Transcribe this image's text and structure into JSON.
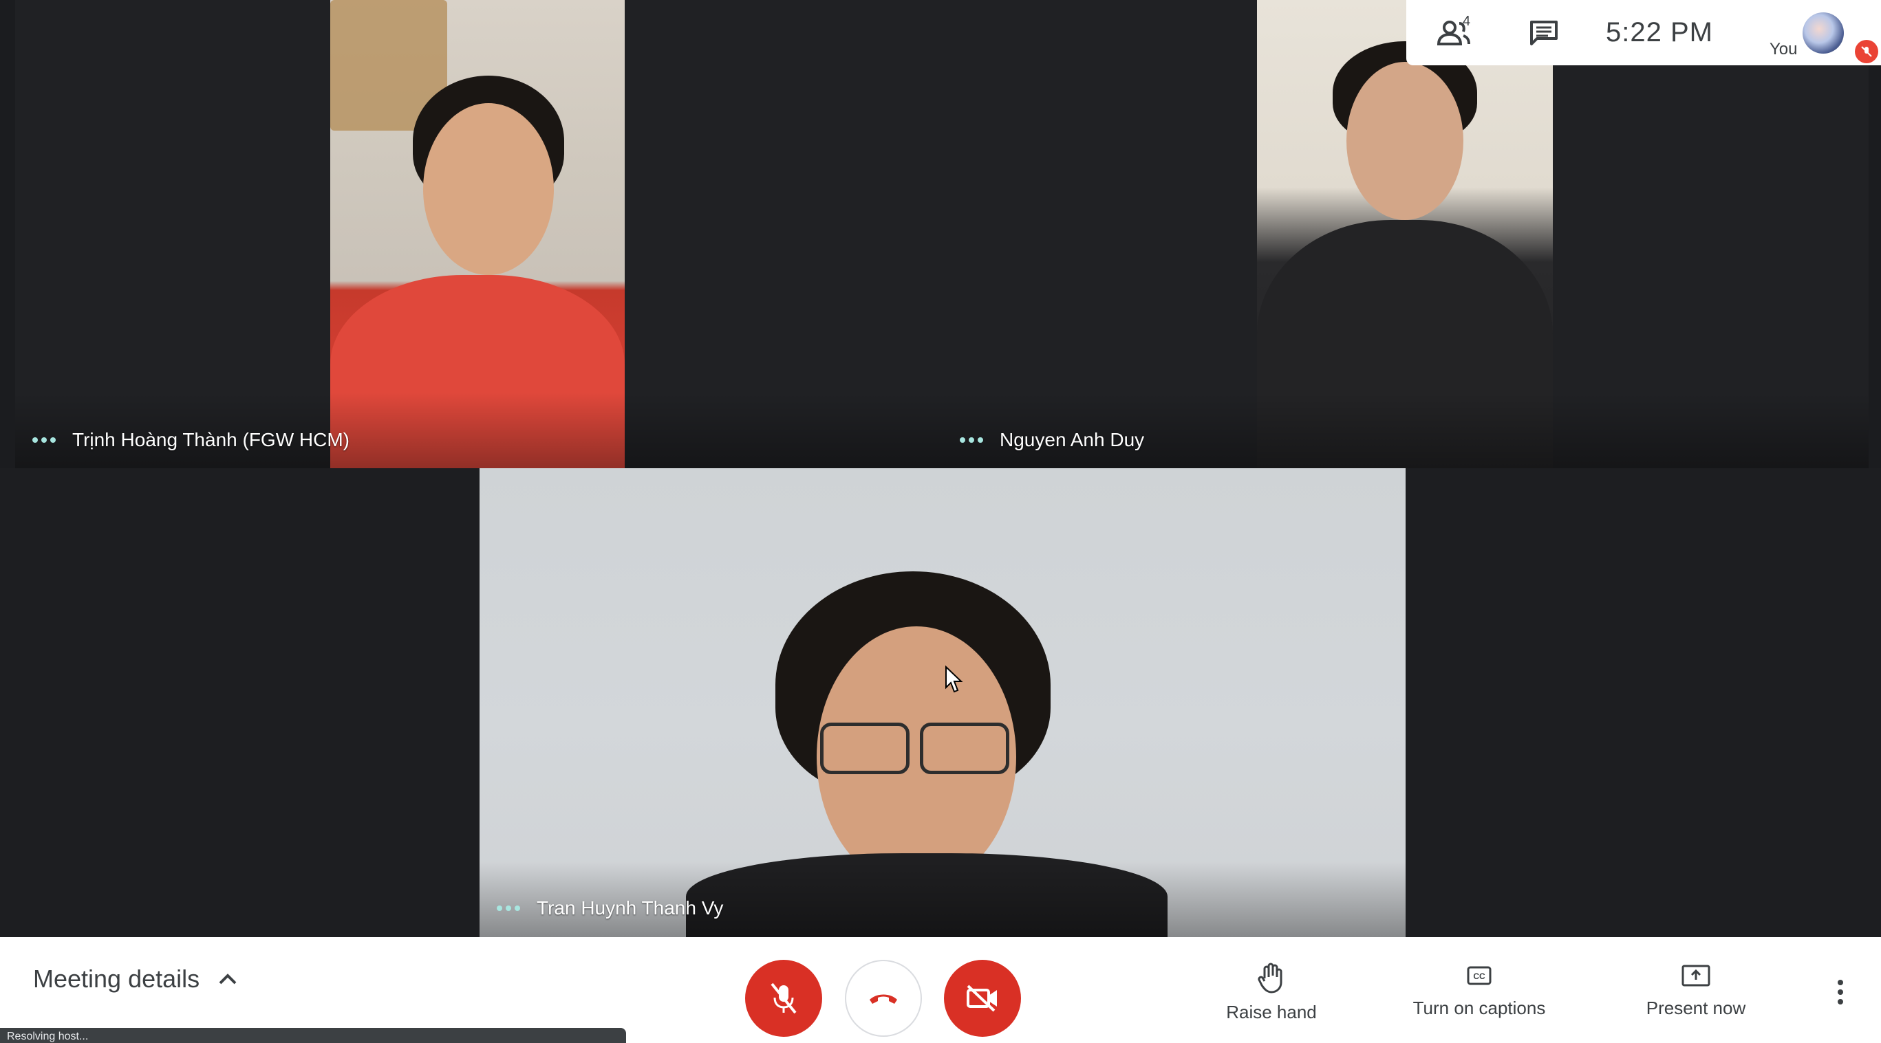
{
  "participants": [
    {
      "name": "Trịnh Hoàng Thành (FGW HCM)"
    },
    {
      "name": "Nguyen Anh Duy"
    },
    {
      "name": "Tran Huynh Thanh Vy"
    }
  ],
  "top_panel": {
    "people_count": "4",
    "people_icon": "people-icon",
    "chat_icon": "chat-icon",
    "time": "5:22  PM",
    "self_label": "You"
  },
  "bottom_bar": {
    "meeting_details": "Meeting details",
    "status_text": "Resolving host...",
    "raise_hand": "Raise hand",
    "captions": "Turn on captions",
    "present": "Present now"
  },
  "colors": {
    "danger": "#d93025",
    "bar_bg": "#ffffff",
    "stage_bg": "#1b1c1f",
    "text_dark": "#3c4043"
  }
}
